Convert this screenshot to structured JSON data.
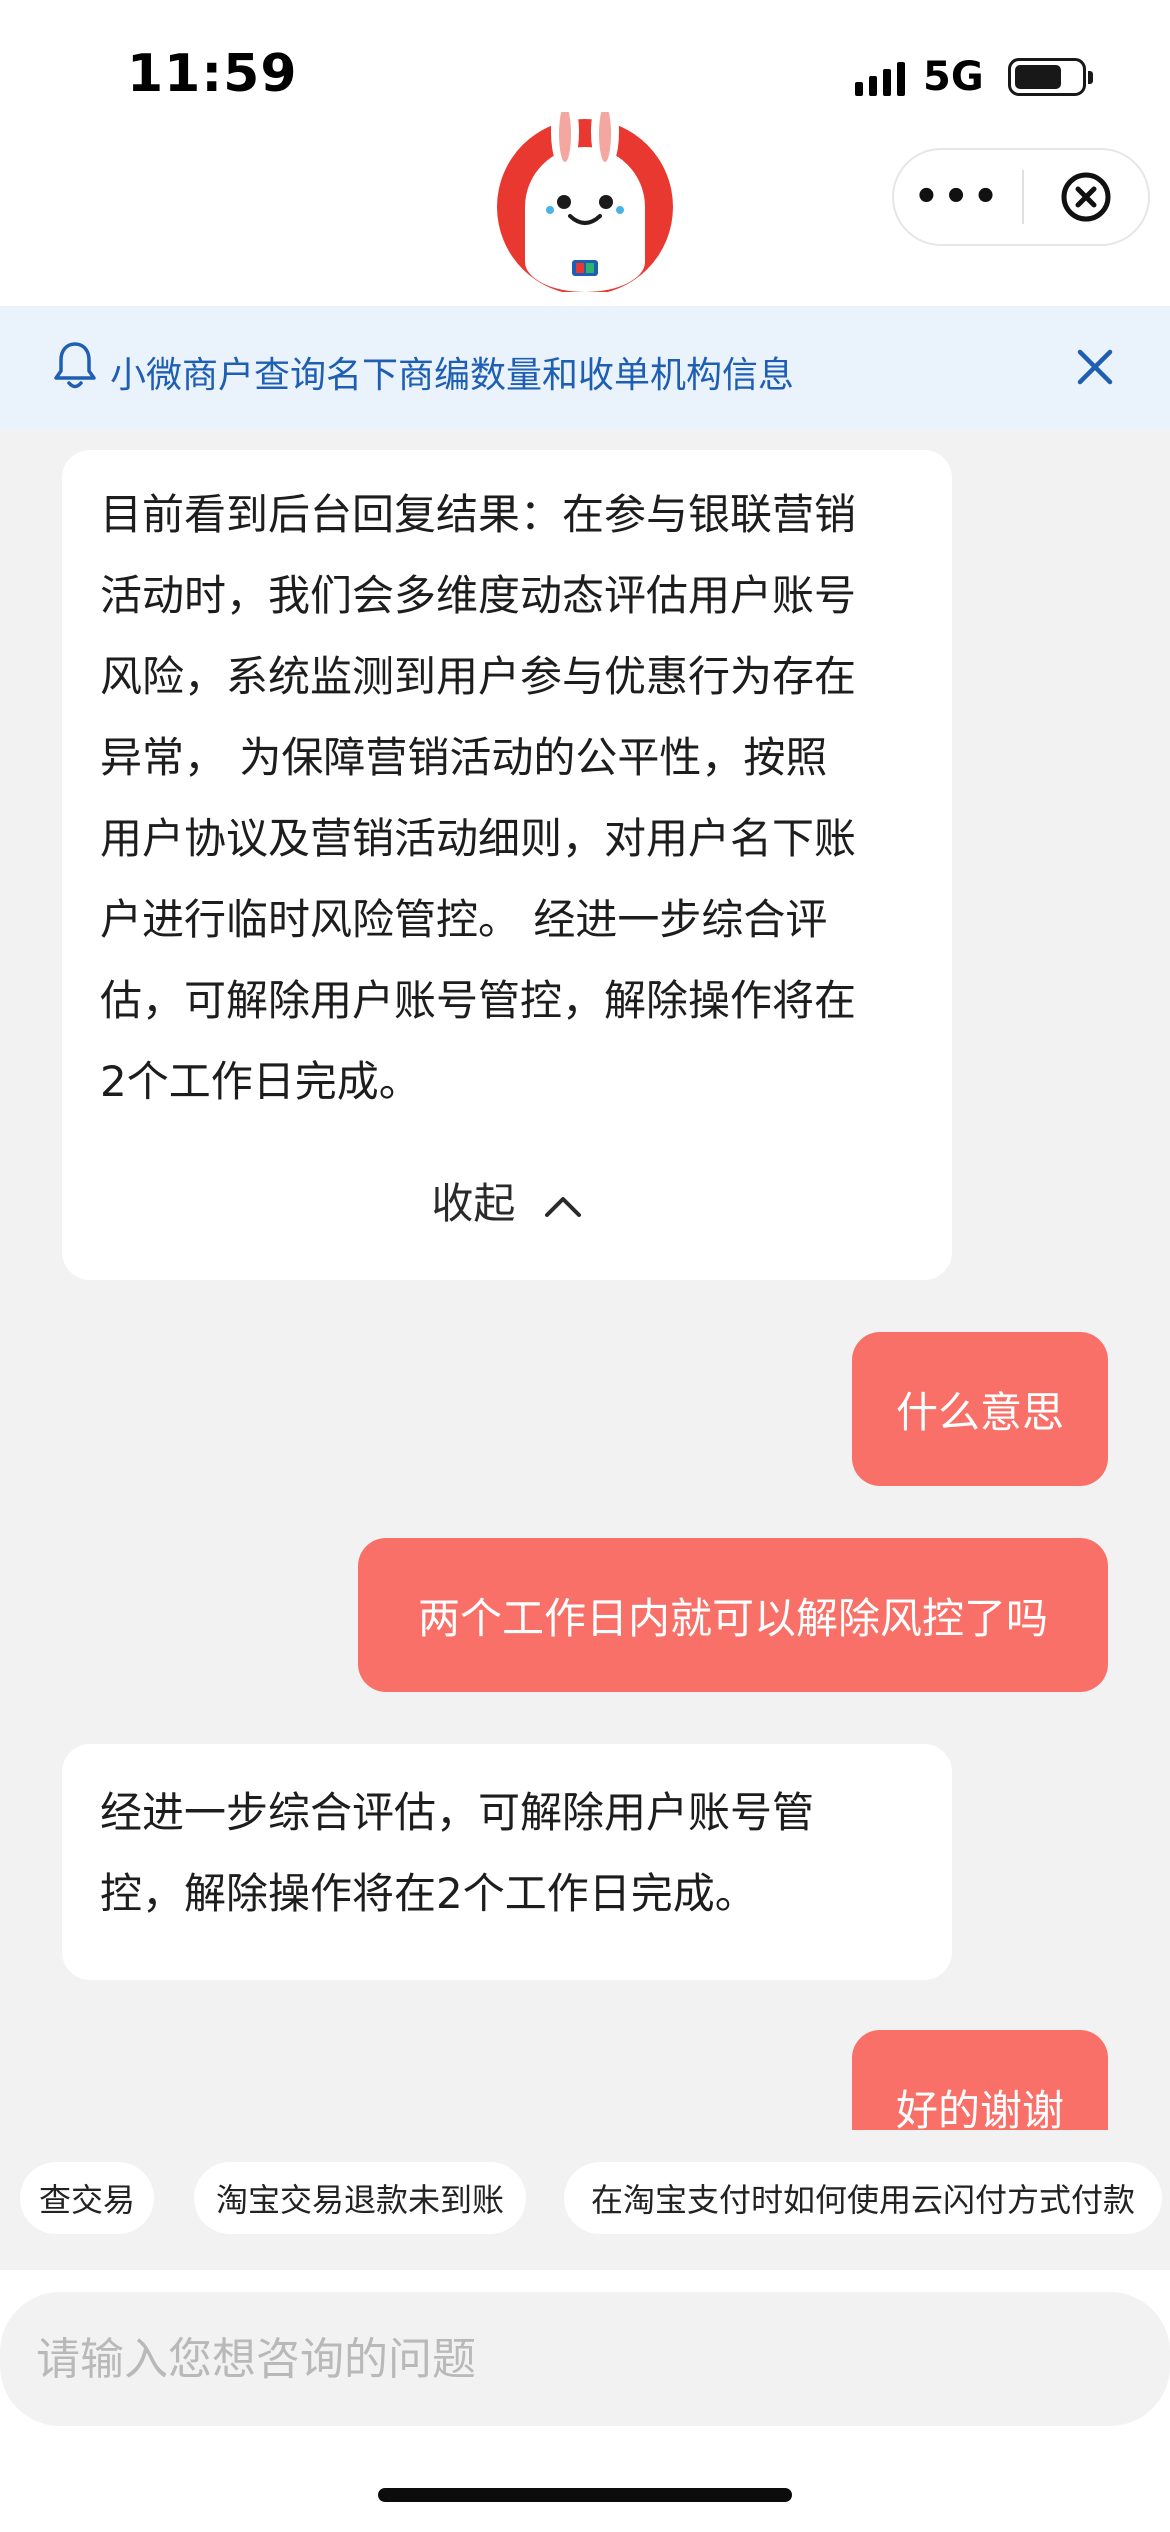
{
  "status_bar": {
    "time": "11:59",
    "network": "5G"
  },
  "header": {
    "more_label": "•••",
    "mascot_icon": "rabbit-mascot-icon",
    "close_icon": "circle-close-icon"
  },
  "notice": {
    "text": "小微商户查询名下商编数量和收单机构信息",
    "color": "#1e5fb3"
  },
  "messages": {
    "m1": {
      "lines": [
        "目前看到后台回复结果：在参与银联营销",
        "活动时，我们会多维度动态评估用户账号",
        "风险，系统监测到用户参与优惠行为存在",
        "异常， 为保障营销活动的公平性，按照",
        "用户协议及营销活动细则，对用户名下账",
        "户进行临时风险管控。 经进一步综合评",
        "估，可解除用户账号管控，解除操作将在",
        "2个工作日完成。"
      ],
      "collapse_label": "收起"
    },
    "m2": {
      "text": "什么意思"
    },
    "m3": {
      "text": "两个工作日内就可以解除风控了吗"
    },
    "m4": {
      "lines": [
        "经进一步综合评估，可解除用户账号管",
        "控，解除操作将在2个工作日完成。"
      ]
    },
    "m5": {
      "text": "好的谢谢"
    }
  },
  "quick_replies": [
    "查交易",
    "淘宝交易退款未到账",
    "在淘宝支付时如何使用云闪付方式付款"
  ],
  "input": {
    "placeholder": "请输入您想咨询的问题"
  },
  "colors": {
    "user_bubble": "#f97068",
    "accent_blue": "#1e5fb3",
    "background": "#f2f2f2"
  }
}
